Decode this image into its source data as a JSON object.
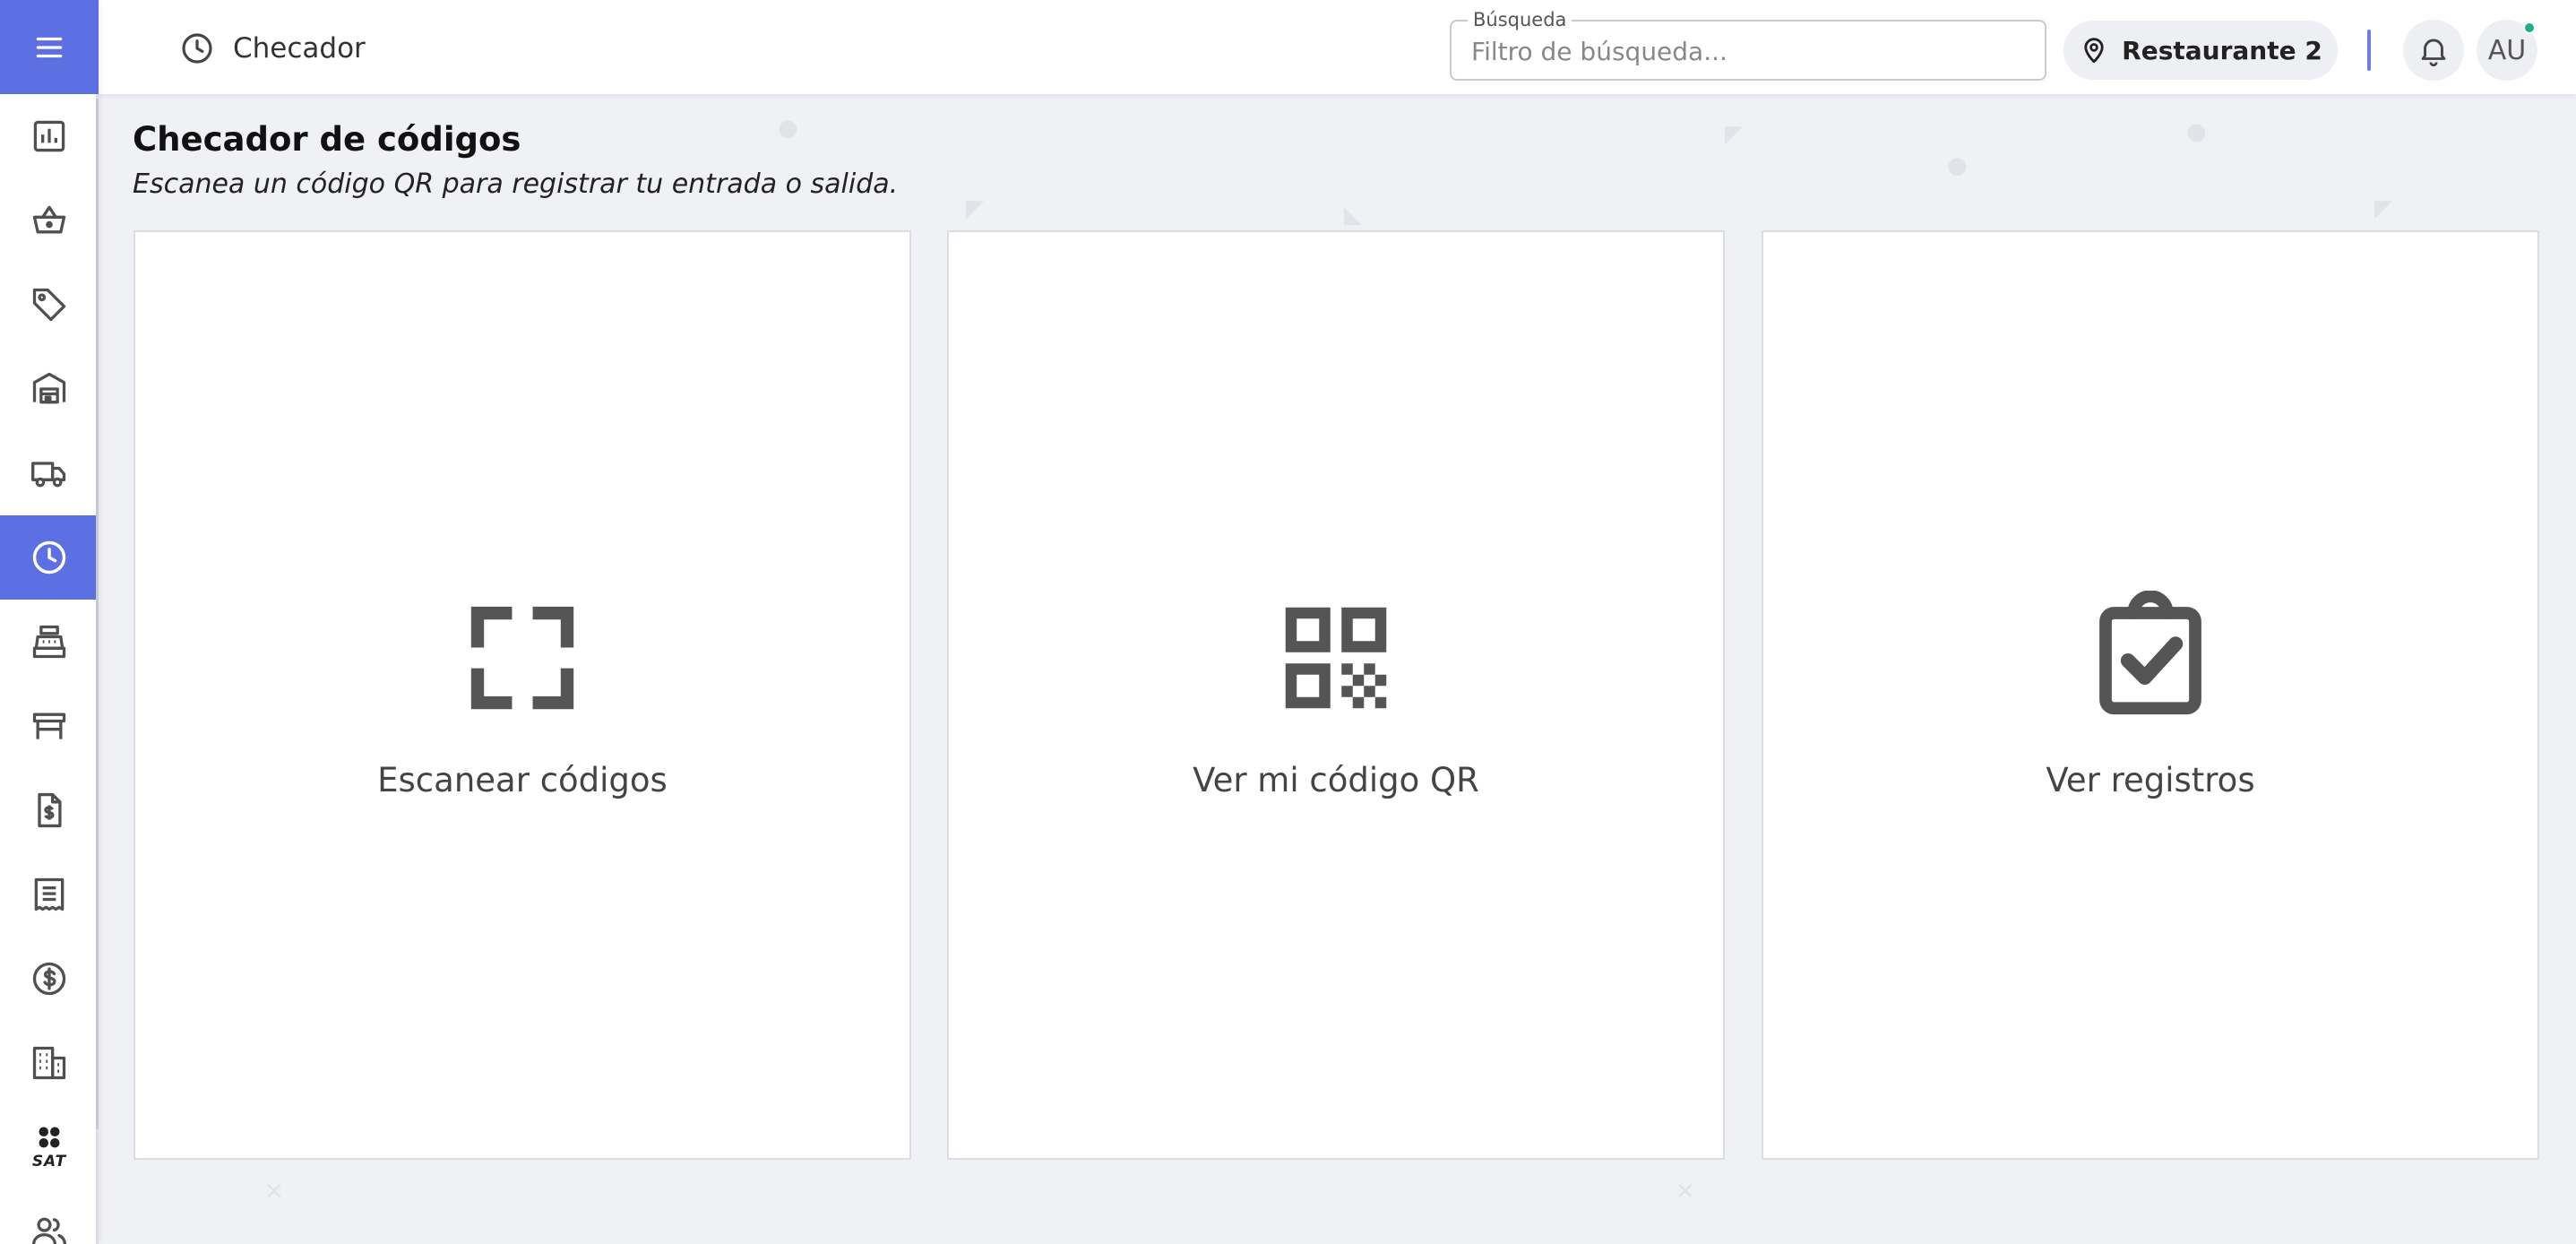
{
  "header": {
    "title": "Checador",
    "search": {
      "legend": "Búsqueda",
      "placeholder": "Filtro de búsqueda..."
    },
    "location": "Restaurante 2",
    "avatar_initials": "AU"
  },
  "sidebar": {
    "items": [
      {
        "name": "reports",
        "icon": "bar-chart-icon",
        "active": false
      },
      {
        "name": "sales",
        "icon": "basket-icon",
        "active": false
      },
      {
        "name": "products",
        "icon": "tag-icon",
        "active": false
      },
      {
        "name": "warehouse",
        "icon": "warehouse-icon",
        "active": false
      },
      {
        "name": "deliveries",
        "icon": "truck-icon",
        "active": false
      },
      {
        "name": "checador",
        "icon": "clock-icon",
        "active": true
      },
      {
        "name": "cash-register",
        "icon": "cash-register-icon",
        "active": false
      },
      {
        "name": "tables",
        "icon": "table-icon",
        "active": false
      },
      {
        "name": "invoices",
        "icon": "invoice-icon",
        "active": false
      },
      {
        "name": "receipts",
        "icon": "receipt-icon",
        "active": false
      },
      {
        "name": "payments",
        "icon": "dollar-circle-icon",
        "active": false
      },
      {
        "name": "buildings",
        "icon": "building-icon",
        "active": false
      },
      {
        "name": "sat",
        "icon": "sat-icon",
        "label": "SAT",
        "active": false
      },
      {
        "name": "users",
        "icon": "users-icon",
        "active": false
      }
    ]
  },
  "main": {
    "title": "Checador de códigos",
    "subtitle": "Escanea un código QR para registrar tu entrada o salida.",
    "cards": [
      {
        "label": "Escanear códigos",
        "icon": "scan-frame-icon"
      },
      {
        "label": "Ver mi código QR",
        "icon": "qr-code-icon"
      },
      {
        "label": "Ver registros",
        "icon": "clipboard-check-icon"
      }
    ]
  },
  "colors": {
    "accent": "#5c6fe3",
    "background": "#f0f1f5",
    "status_online": "#1fae8a"
  }
}
